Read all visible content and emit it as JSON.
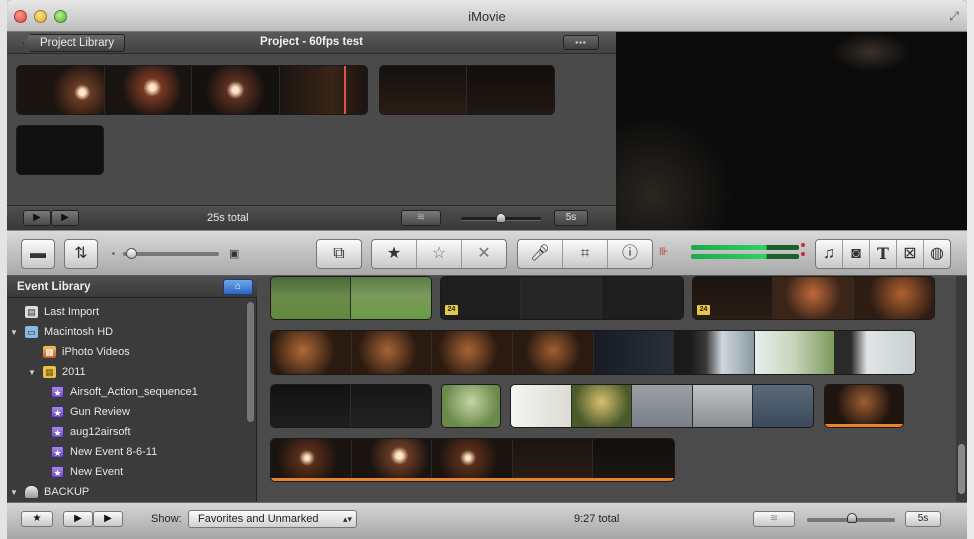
{
  "window": {
    "title": "iMovie"
  },
  "project": {
    "library_button": "Project Library",
    "title": "Project - 60fps test",
    "total": "25s total",
    "duration": "5s"
  },
  "event_library": {
    "title": "Event Library",
    "items": [
      {
        "label": "Last Import",
        "icon": "film-icon"
      },
      {
        "label": "Macintosh HD",
        "icon": "monitor-icon"
      },
      {
        "label": "iPhoto Videos",
        "icon": "iphoto-icon"
      },
      {
        "label": "2011",
        "icon": "folder-icon"
      },
      {
        "label": "Airsoft_Action_sequence1",
        "icon": "star-icon"
      },
      {
        "label": "Gun Review",
        "icon": "star-icon"
      },
      {
        "label": "aug12airsoft",
        "icon": "star-icon"
      },
      {
        "label": "New Event 8-6-11",
        "icon": "star-icon"
      },
      {
        "label": "New Event",
        "icon": "star-icon"
      },
      {
        "label": "BACKUP",
        "icon": "drive-icon"
      }
    ]
  },
  "clips": {
    "badge": "24"
  },
  "bottom": {
    "show_label": "Show:",
    "show_value": "Favorites and Unmarked",
    "total": "9:27 total",
    "duration": "5s"
  },
  "colors": {
    "accent": "#2a66c4",
    "reject": "#8a8a8a",
    "audio_meter": "#2bd561",
    "clip_used": "#e9842d"
  }
}
